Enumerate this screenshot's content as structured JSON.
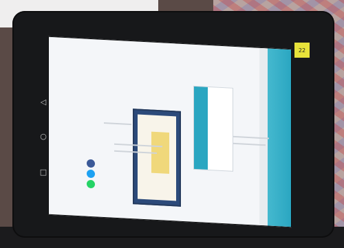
{
  "scene": {
    "sticker_label": "22",
    "nav_keys": [
      "◁",
      "○",
      "□"
    ]
  },
  "colors": {
    "browser_accent": "#2aa6c1",
    "certificate_frame": "#2c4a7a",
    "tablet_body": "#17181a"
  },
  "icons": [
    "back-icon",
    "home-icon",
    "recent-apps-icon",
    "facebook-icon",
    "twitter-icon",
    "whatsapp-icon"
  ]
}
